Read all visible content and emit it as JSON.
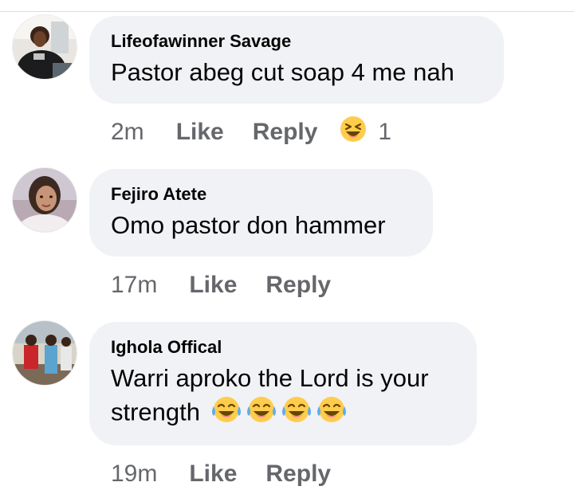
{
  "comments": [
    {
      "author": "Lifeofawinner Savage",
      "text": "Pastor abeg cut soap 4 me nah",
      "time": "2m",
      "like_label": "Like",
      "reply_label": "Reply",
      "reaction": {
        "icon": "laughing-squint-icon",
        "count": "1"
      }
    },
    {
      "author": "Fejiro Atete",
      "text": "Omo pastor don hammer",
      "time": "17m",
      "like_label": "Like",
      "reply_label": "Reply"
    },
    {
      "author": "Ighola Offical",
      "text_line1": "Warri aproko the Lord is your",
      "text_line2": "strength",
      "emojis": [
        "tears-of-joy-icon",
        "tears-of-joy-icon",
        "tears-of-joy-icon",
        "tears-of-joy-icon"
      ],
      "time": "19m",
      "like_label": "Like",
      "reply_label": "Reply"
    }
  ],
  "colors": {
    "bubble": "#f0f2f5",
    "meta_text": "#65676b",
    "emoji_yellow": "#ffcc4d",
    "tear_blue": "#5dadec"
  }
}
